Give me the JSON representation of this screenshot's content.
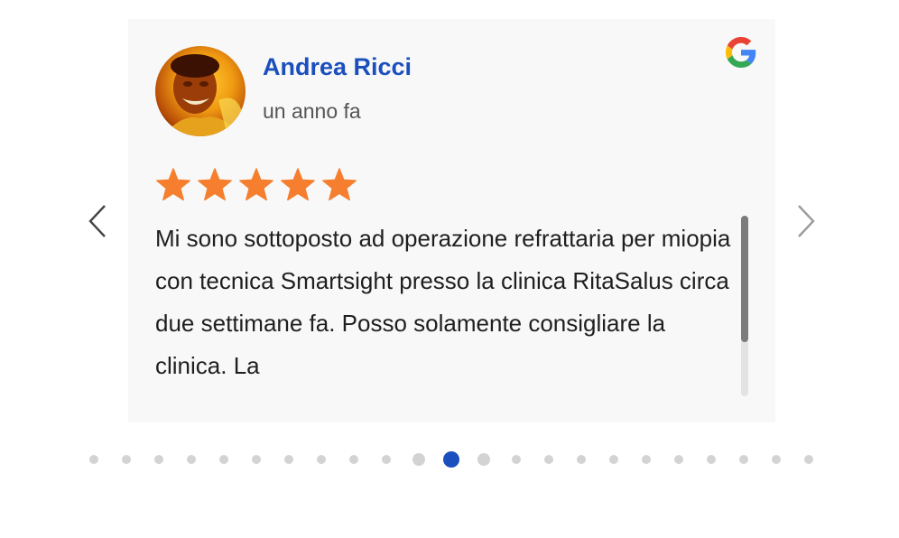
{
  "review": {
    "author": "Andrea Ricci",
    "date": "un anno fa",
    "rating": 5,
    "rating_max": 5,
    "text": "Mi sono sottoposto ad operazione refrattaria per miopia con tecnica Smartsight presso la clinica RitaSalus circa due settimane fa. Posso solamente consigliare la clinica. La",
    "source_icon": "google-icon"
  },
  "colors": {
    "author_name": "#1b4fbd",
    "star": "#f57f2e",
    "dot_active": "#1b4fbd",
    "dot_inactive": "#d3d3d3",
    "card_bg": "#f8f8f8"
  },
  "carousel": {
    "dot_count": 23,
    "active_index": 11,
    "prev_icon": "chevron-left-icon",
    "next_icon": "chevron-right-icon"
  }
}
